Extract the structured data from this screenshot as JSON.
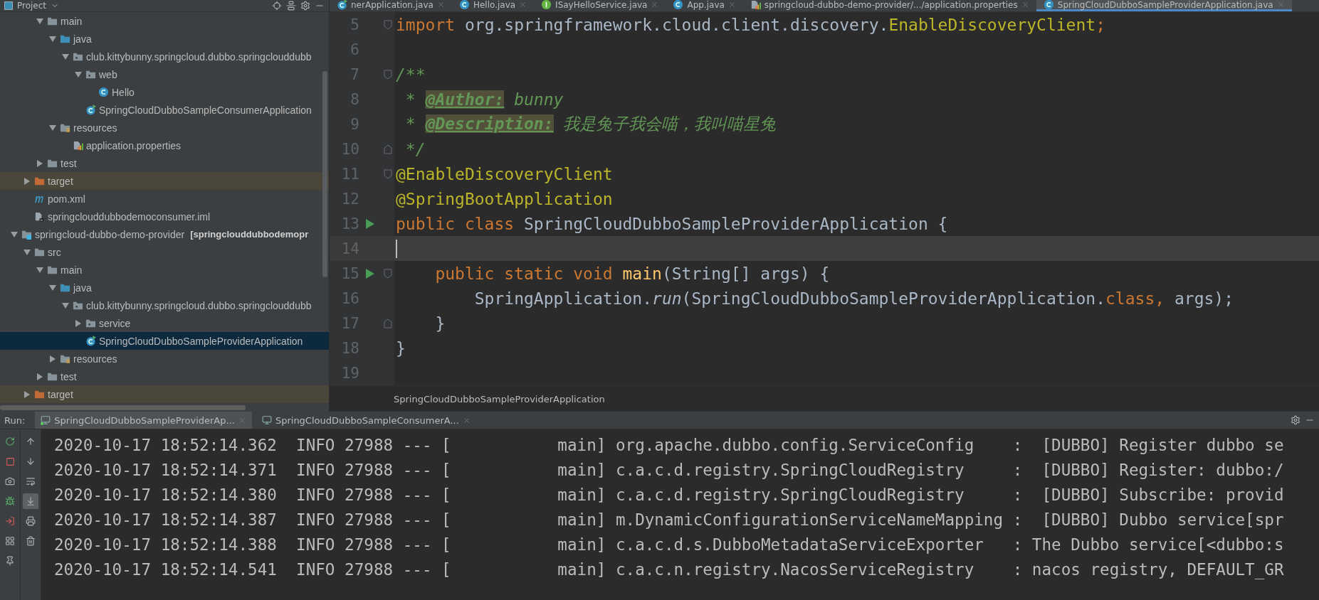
{
  "project_panel": {
    "title": "Project"
  },
  "tree": {
    "items": [
      {
        "children": [
          {
            "children": [
              {
                "label": "main",
                "kind": "folder",
                "expanded": true,
                "selected": false,
                "excluded": false,
                "children": [
                  {
                    "label": "java",
                    "kind": "source-folder",
                    "expanded": true,
                    "selected": false,
                    "excluded": false,
                    "children": [
                      {
                        "label": "club.kittybunny.springcloud.dubbo.springclouddubb",
                        "kind": "package",
                        "expanded": true,
                        "selected": false,
                        "excluded": false,
                        "children": [
                          {
                            "label": "web",
                            "kind": "package",
                            "expanded": true,
                            "selected": false,
                            "excluded": false,
                            "children": [
                              {
                                "label": "Hello",
                                "kind": "class",
                                "selected": false,
                                "excluded": false
                              }
                            ]
                          },
                          {
                            "label": "SpringCloudDubboSampleConsumerApplication",
                            "kind": "app-class",
                            "selected": false,
                            "excluded": false
                          }
                        ]
                      }
                    ]
                  },
                  {
                    "label": "resources",
                    "kind": "resources",
                    "expanded": true,
                    "selected": false,
                    "excluded": false,
                    "children": [
                      {
                        "label": "application.properties",
                        "kind": "properties",
                        "selected": false,
                        "excluded": false
                      }
                    ]
                  }
                ]
              },
              {
                "label": "test",
                "kind": "folder",
                "expanded": false,
                "selected": false,
                "excluded": false
              }
            ]
          },
          {
            "label": "target",
            "kind": "excluded-folder",
            "expanded": false,
            "selected": false,
            "excluded": true
          },
          {
            "label": "pom.xml",
            "kind": "maven",
            "selected": false,
            "excluded": false
          },
          {
            "label": "springclouddubbodemoconsumer.iml",
            "kind": "iml",
            "selected": false,
            "excluded": false
          }
        ]
      },
      {
        "label": "springcloud-dubbo-demo-provider",
        "module": "[springclouddubbodemopr",
        "kind": "module",
        "expanded": true,
        "selected": false,
        "excluded": false,
        "children": [
          {
            "label": "src",
            "kind": "folder",
            "expanded": true,
            "selected": false,
            "excluded": false,
            "children": [
              {
                "label": "main",
                "kind": "folder",
                "expanded": true,
                "selected": false,
                "excluded": false,
                "children": [
                  {
                    "label": "java",
                    "kind": "source-folder",
                    "expanded": true,
                    "selected": false,
                    "excluded": false,
                    "children": [
                      {
                        "label": "club.kittybunny.springcloud.dubbo.springclouddubb",
                        "kind": "package",
                        "expanded": true,
                        "selected": false,
                        "excluded": false,
                        "children": [
                          {
                            "label": "service",
                            "kind": "package",
                            "expanded": false,
                            "selected": false,
                            "excluded": false
                          },
                          {
                            "label": "SpringCloudDubboSampleProviderApplication",
                            "kind": "app-class",
                            "selected": true,
                            "excluded": false
                          }
                        ]
                      }
                    ]
                  },
                  {
                    "label": "resources",
                    "kind": "resources",
                    "expanded": false,
                    "selected": false,
                    "excluded": false
                  }
                ]
              },
              {
                "label": "test",
                "kind": "folder",
                "expanded": false,
                "selected": false,
                "excluded": false
              }
            ]
          },
          {
            "label": "target",
            "kind": "excluded-folder",
            "expanded": false,
            "selected": false,
            "excluded": true
          }
        ]
      }
    ]
  },
  "editor_tabs": [
    {
      "label": "nerApplication.java",
      "kind": "app-class",
      "selected": false
    },
    {
      "label": "Hello.java",
      "kind": "class",
      "selected": false
    },
    {
      "label": "ISayHelloService.java",
      "kind": "interface",
      "selected": false
    },
    {
      "label": "App.java",
      "kind": "class",
      "selected": false
    },
    {
      "label": "springcloud-dubbo-demo-provider/.../application.properties",
      "kind": "properties",
      "selected": false
    },
    {
      "label": "SpringCloudDubboSampleProviderApplication.java",
      "kind": "class",
      "selected": true
    }
  ],
  "editor": {
    "lines": [
      {
        "number": "5",
        "fold_start": true,
        "fold_end": false,
        "run": false,
        "current": false,
        "tokens": [
          {
            "kind": "keyword",
            "text": "import "
          },
          {
            "kind": "plain",
            "text": "org.springframework.cloud.client.discovery."
          },
          {
            "kind": "annotation",
            "text": "EnableDiscoveryClient"
          },
          {
            "kind": "keyword",
            "text": ";"
          }
        ]
      },
      {
        "number": "6",
        "fold_start": false,
        "fold_end": false,
        "run": false,
        "current": false
      },
      {
        "number": "7",
        "fold_start": true,
        "fold_end": false,
        "run": false,
        "current": false,
        "tokens": [
          {
            "kind": "doc",
            "text": "/**"
          }
        ]
      },
      {
        "number": "8",
        "fold_start": false,
        "fold_end": false,
        "run": false,
        "current": false,
        "tokens": [
          {
            "kind": "doc",
            "text": " * "
          },
          {
            "kind": "doctag",
            "text": "@Author:"
          },
          {
            "kind": "doc",
            "text": " bunny"
          }
        ]
      },
      {
        "number": "9",
        "fold_start": false,
        "fold_end": false,
        "run": false,
        "current": false,
        "tokens": [
          {
            "kind": "doc",
            "text": " * "
          },
          {
            "kind": "doctag",
            "text": "@Description:"
          },
          {
            "kind": "doc",
            "text": " 我是兔子我会喵，我叫喵星兔"
          }
        ]
      },
      {
        "number": "10",
        "fold_start": false,
        "fold_end": true,
        "run": false,
        "current": false,
        "tokens": [
          {
            "kind": "doc",
            "text": " */"
          }
        ]
      },
      {
        "number": "11",
        "fold_start": true,
        "fold_end": false,
        "run": false,
        "current": false,
        "tokens": [
          {
            "kind": "annotation",
            "text": "@EnableDiscoveryClient"
          }
        ]
      },
      {
        "number": "12",
        "fold_start": false,
        "fold_end": false,
        "run": false,
        "current": false,
        "tokens": [
          {
            "kind": "annotation",
            "text": "@SpringBootApplication"
          }
        ]
      },
      {
        "number": "13",
        "fold_start": false,
        "fold_end": false,
        "run": true,
        "current": false,
        "tokens": [
          {
            "kind": "keyword",
            "text": "public class "
          },
          {
            "kind": "plain",
            "text": "SpringCloudDubboSampleProviderApplication {"
          }
        ]
      },
      {
        "number": "14",
        "fold_start": false,
        "fold_end": false,
        "run": false,
        "current": true
      },
      {
        "number": "15",
        "fold_start": true,
        "fold_end": false,
        "run": true,
        "current": false,
        "tokens": [
          {
            "kind": "keyword",
            "text": "    public static void "
          },
          {
            "kind": "method",
            "text": "main"
          },
          {
            "kind": "plain",
            "text": "(String[] args) {"
          }
        ]
      },
      {
        "number": "16",
        "fold_start": false,
        "fold_end": false,
        "run": false,
        "current": false,
        "tokens": [
          {
            "kind": "plain",
            "text": "        SpringApplication."
          },
          {
            "kind": "static",
            "text": "run"
          },
          {
            "kind": "plain",
            "text": "(SpringCloudDubboSampleProviderApplication."
          },
          {
            "kind": "keyword",
            "text": "class, "
          },
          {
            "kind": "plain",
            "text": "args);"
          }
        ]
      },
      {
        "number": "17",
        "fold_start": false,
        "fold_end": true,
        "run": false,
        "current": false,
        "tokens": [
          {
            "kind": "plain",
            "text": "    }"
          }
        ]
      },
      {
        "number": "18",
        "fold_start": false,
        "fold_end": false,
        "run": false,
        "current": false,
        "tokens": [
          {
            "kind": "plain",
            "text": "}"
          }
        ]
      },
      {
        "number": "19",
        "fold_start": false,
        "fold_end": false,
        "run": false,
        "current": false
      }
    ],
    "breadcrumb": "SpringCloudDubboSampleProviderApplication"
  },
  "run_panel": {
    "label": "Run:",
    "tabs": [
      {
        "label": "SpringCloudDubboSampleProviderAp...",
        "selected": true,
        "running": true
      },
      {
        "label": "SpringCloudDubboSampleConsumerA...",
        "selected": false,
        "running": false
      }
    ],
    "scroll_to_end": true,
    "soft_wrap": false,
    "console": [
      "2020-10-17 18:52:14.362  INFO 27988 --- [           main] org.apache.dubbo.config.ServiceConfig    :  [DUBBO] Register dubbo se",
      "2020-10-17 18:52:14.371  INFO 27988 --- [           main] c.a.c.d.registry.SpringCloudRegistry     :  [DUBBO] Register: dubbo:/",
      "2020-10-17 18:52:14.380  INFO 27988 --- [           main] c.a.c.d.registry.SpringCloudRegistry     :  [DUBBO] Subscribe: provid",
      "2020-10-17 18:52:14.387  INFO 27988 --- [           main] m.DynamicConfigurationServiceNameMapping :  [DUBBO] Dubbo service[spr",
      "2020-10-17 18:52:14.388  INFO 27988 --- [           main] c.a.c.d.s.DubboMetadataServiceExporter   : The Dubbo service[<dubbo:s",
      "2020-10-17 18:52:14.541  INFO 27988 --- [           main] c.a.c.n.registry.NacosServiceRegistry    : nacos registry, DEFAULT_GR"
    ]
  }
}
